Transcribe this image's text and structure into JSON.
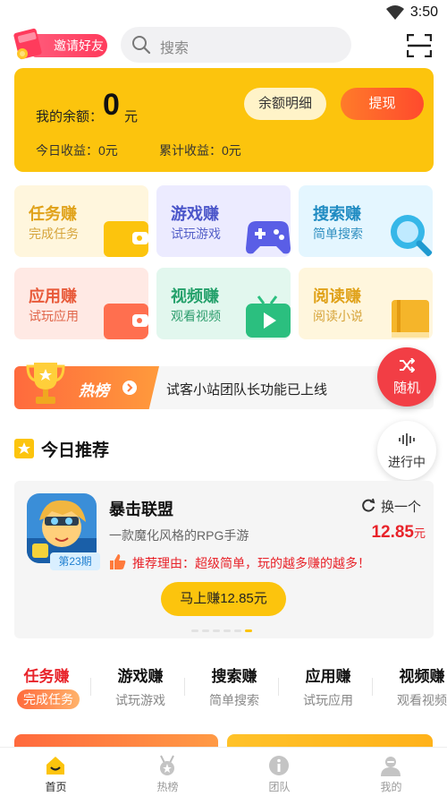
{
  "status_bar": {
    "time": "3:50"
  },
  "header": {
    "invite_label": "邀请好友",
    "search_placeholder": "搜索"
  },
  "balance": {
    "label": "我的余额：",
    "value": "0",
    "unit": "元",
    "detail_button": "余额明细",
    "withdraw_button": "提现",
    "today_earnings": "今日收益：0元",
    "total_earnings": "累计收益：0元"
  },
  "tasks": [
    {
      "title": "任务赚",
      "subtitle": "完成任务",
      "icon": "wallet-icon"
    },
    {
      "title": "游戏赚",
      "subtitle": "试玩游戏",
      "icon": "gamepad-icon"
    },
    {
      "title": "搜索赚",
      "subtitle": "简单搜索",
      "icon": "magnifier-icon"
    },
    {
      "title": "应用赚",
      "subtitle": "试玩应用",
      "icon": "wallet-icon"
    },
    {
      "title": "视频赚",
      "subtitle": "观看视频",
      "icon": "tv-icon"
    },
    {
      "title": "阅读赚",
      "subtitle": "阅读小说",
      "icon": "book-icon"
    }
  ],
  "hot": {
    "label": "热榜",
    "text": "试客小站团队长功能已上线"
  },
  "float_buttons": {
    "random": "随机",
    "in_progress": "进行中"
  },
  "recommend": {
    "section_title": "今日推荐",
    "game_name": "暴击联盟",
    "issue": "第23期",
    "swap_label": "换一个",
    "description": "一款魔化风格的RPG手游",
    "reward_value": "12.85",
    "reward_unit": "元",
    "reason": "推荐理由：超级简单，玩的越多赚的越多！",
    "earn_button": "马上赚12.85元",
    "carousel_pages": 6,
    "carousel_active": 6
  },
  "categories": [
    {
      "title": "任务赚",
      "subtitle": "完成任务",
      "active": true
    },
    {
      "title": "游戏赚",
      "subtitle": "试玩游戏"
    },
    {
      "title": "搜索赚",
      "subtitle": "简单搜索"
    },
    {
      "title": "应用赚",
      "subtitle": "试玩应用"
    },
    {
      "title": "视频赚",
      "subtitle": "观看视频"
    }
  ],
  "tabbar": [
    {
      "label": "首页",
      "icon": "home-icon",
      "active": true
    },
    {
      "label": "热榜",
      "icon": "medal-icon"
    },
    {
      "label": "团队",
      "icon": "info-icon"
    },
    {
      "label": "我的",
      "icon": "user-icon"
    }
  ],
  "colors": {
    "brand_yellow": "#fcc40d",
    "accent_red": "#e8232a",
    "accent_orange": "#ff6a3d"
  }
}
